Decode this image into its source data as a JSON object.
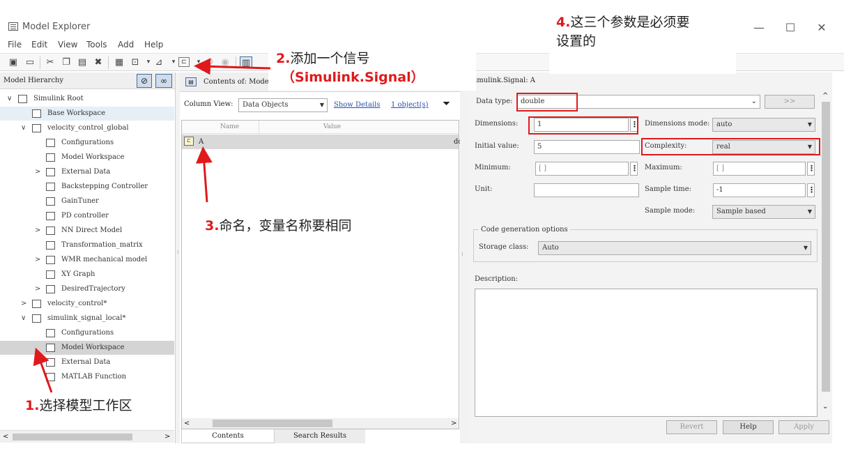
{
  "window": {
    "title": "Model Explorer",
    "minimize": "—",
    "maximize": "☐",
    "close": "✕"
  },
  "menu": [
    "File",
    "Edit",
    "View",
    "Tools",
    "Add",
    "Help"
  ],
  "left_pane": {
    "header": "Model Hierarchy",
    "tree": [
      {
        "label": "Simulink Root",
        "depth": 0,
        "chevron": "∨"
      },
      {
        "label": "Base Workspace",
        "depth": 1,
        "chevron": ""
      },
      {
        "label": "velocity_control_global",
        "depth": 1,
        "chevron": "∨"
      },
      {
        "label": "Configurations",
        "depth": 2,
        "chevron": ""
      },
      {
        "label": "Model Workspace",
        "depth": 2,
        "chevron": ""
      },
      {
        "label": "External Data",
        "depth": 2,
        "chevron": ">"
      },
      {
        "label": "Backstepping Controller",
        "depth": 2,
        "chevron": ""
      },
      {
        "label": "GainTuner",
        "depth": 2,
        "chevron": ""
      },
      {
        "label": "PD controller",
        "depth": 2,
        "chevron": ""
      },
      {
        "label": "NN Direct Model",
        "depth": 2,
        "chevron": ">"
      },
      {
        "label": "Transformation_matrix",
        "depth": 2,
        "chevron": ""
      },
      {
        "label": "WMR mechanical model",
        "depth": 2,
        "chevron": ">"
      },
      {
        "label": "XY Graph",
        "depth": 2,
        "chevron": ""
      },
      {
        "label": "DesiredTrajectory",
        "depth": 2,
        "chevron": ">"
      },
      {
        "label": "velocity_control*",
        "depth": 1,
        "chevron": ">"
      },
      {
        "label": "simulink_signal_local*",
        "depth": 1,
        "chevron": "∨"
      },
      {
        "label": "Configurations",
        "depth": 2,
        "chevron": ""
      },
      {
        "label": "Model Workspace",
        "depth": 2,
        "chevron": ""
      },
      {
        "label": "External Data",
        "depth": 2,
        "chevron": ""
      },
      {
        "label": "MATLAB Function",
        "depth": 2,
        "chevron": ""
      }
    ]
  },
  "mid_pane": {
    "header": "Contents of: Mode",
    "column_view_label": "Column View:",
    "column_view_value": "Data Objects",
    "show_details": "Show Details",
    "object_count": "1 object(s)",
    "col_name": "Name",
    "col_value": "Value",
    "row_name": "A",
    "row_value": "do",
    "tab_contents": "Contents",
    "tab_search": "Search Results"
  },
  "right_pane": {
    "header": "imulink.Signal: A",
    "data_type_label": "Data type:",
    "data_type_value": "double",
    "arrow_button": ">>",
    "dimensions_label": "Dimensions:",
    "dimensions_value": "1",
    "dimensions_mode_label": "Dimensions mode:",
    "dimensions_mode_value": "auto",
    "initial_value_label": "Initial value:",
    "initial_value": "5",
    "complexity_label": "Complexity:",
    "complexity_value": "real",
    "minimum_label": "Minimum:",
    "minimum_value": "[ ]",
    "maximum_label": "Maximum:",
    "maximum_value": "[ ]",
    "unit_label": "Unit:",
    "unit_value": "",
    "sample_time_label": "Sample time:",
    "sample_time_value": "-1",
    "sample_mode_label": "Sample mode:",
    "sample_mode_value": "Sample based",
    "code_gen_label": "Code generation options",
    "storage_class_label": "Storage class:",
    "storage_class_value": "Auto",
    "description_label": "Description:",
    "revert": "Revert",
    "help": "Help",
    "apply": "Apply"
  },
  "annotations": {
    "a1_num": "1.",
    "a1_text": "选择模型工作区",
    "a2_num": "2.",
    "a2_text": "添加一个信号",
    "a2_sub_open": "（",
    "a2_sub": "Simulink.Signal",
    "a2_sub_close": "）",
    "a3_num": "3.",
    "a3_text": "命名，变量名称要相同",
    "a4_num": "4.",
    "a4_text": "这三个参数是必须要",
    "a4_text2": "设置的"
  },
  "colors": {
    "annotation_red": "#e0191b",
    "link_blue": "#2a4fa8",
    "selection_gray": "#d4d4d4"
  }
}
